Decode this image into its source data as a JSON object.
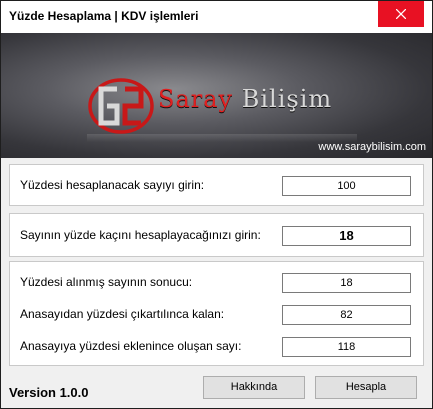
{
  "window": {
    "title": "Yüzde Hesaplama | KDV işlemleri"
  },
  "banner": {
    "logo_first_word": "Saray",
    "logo_second_word": "Bilişim",
    "url": "www.saraybilisim.com"
  },
  "inputs": {
    "number_label": "Yüzdesi hesaplanacak sayıyı girin:",
    "number_value": "100",
    "percent_label": "Sayının yüzde kaçını hesaplayacağınızı girin:",
    "percent_value": "18"
  },
  "results": {
    "percent_result_label": "Yüzdesi alınmış sayının sonucu:",
    "percent_result_value": "18",
    "subtracted_label": "Anasayıdan yüzdesi çıkartılınca kalan:",
    "subtracted_value": "82",
    "added_label": "Anasayıya yüzdesi eklenince oluşan sayı:",
    "added_value": "118"
  },
  "footer": {
    "version": "Version 1.0.0",
    "about_button": "Hakkında",
    "calculate_button": "Hesapla"
  },
  "colors": {
    "close_button": "#e81123",
    "brand_red": "#e02020",
    "banner_dark": "#27272b"
  }
}
